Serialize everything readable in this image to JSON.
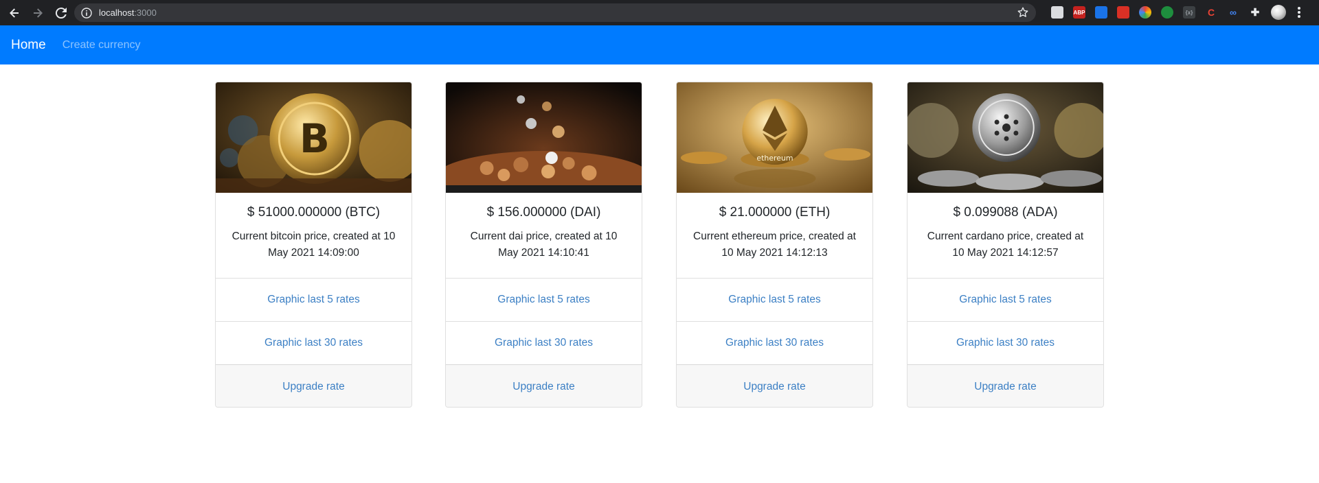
{
  "browser": {
    "url_host": "localhost",
    "url_port": ":3000"
  },
  "navbar": {
    "brand": "Home",
    "links": [
      "Create currency"
    ]
  },
  "cards": [
    {
      "image": "bitcoin-coin-photo",
      "title": "$ 51000.000000 (BTC)",
      "text": "Current bitcoin price, created at 10 May 2021 14:09:00",
      "links": [
        "Graphic last 5 rates",
        "Graphic last 30 rates"
      ],
      "footer": "Upgrade rate"
    },
    {
      "image": "dai-coins-photo",
      "title": "$ 156.000000 (DAI)",
      "text": "Current dai price, created at 10 May 2021 14:10:41",
      "links": [
        "Graphic last 5 rates",
        "Graphic last 30 rates"
      ],
      "footer": "Upgrade rate"
    },
    {
      "image": "ethereum-coin-photo",
      "title": "$ 21.000000 (ETH)",
      "text": "Current ethereum price, created at 10 May 2021 14:12:13",
      "links": [
        "Graphic last 5 rates",
        "Graphic last 30 rates"
      ],
      "footer": "Upgrade rate"
    },
    {
      "image": "cardano-coin-photo",
      "title": "$ 0.099088 (ADA)",
      "text": "Current cardano price, created at 10 May 2021 14:12:57",
      "links": [
        "Graphic last 5 rates",
        "Graphic last 30 rates"
      ],
      "footer": "Upgrade rate"
    }
  ],
  "colors": {
    "navbar_bg": "#007bff",
    "link": "#3b7fc4",
    "browser_bg": "#202124"
  }
}
